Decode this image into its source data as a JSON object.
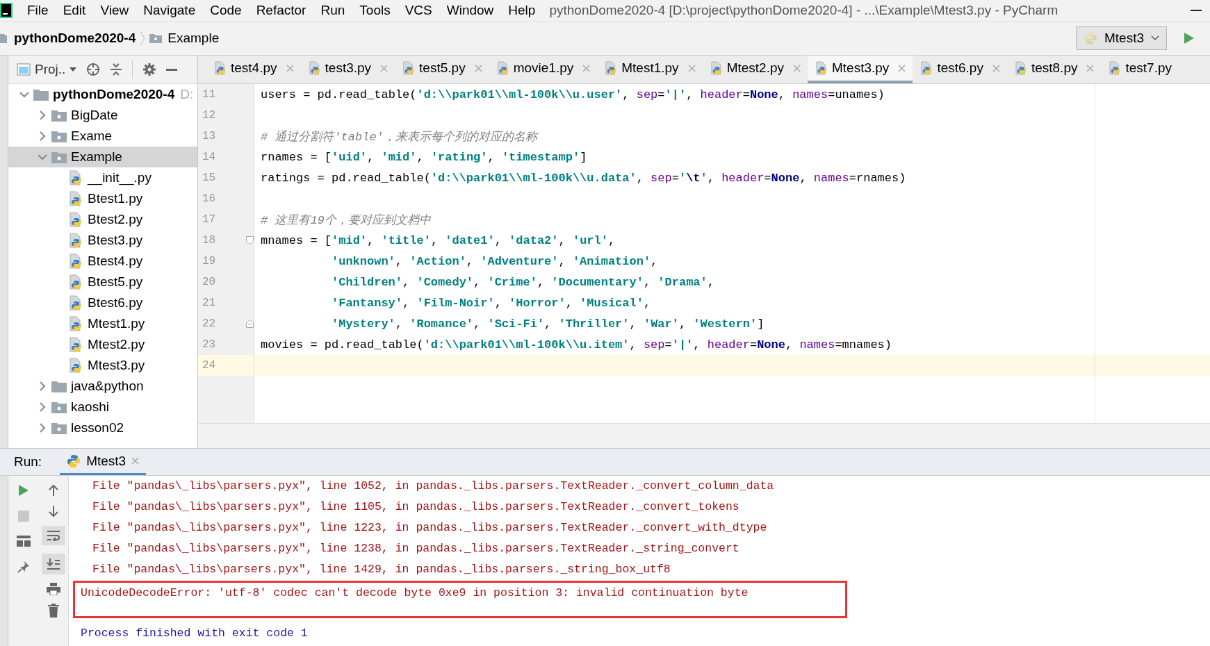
{
  "window": {
    "title": "pythonDome2020-4 [D:\\project\\pythonDome2020-4] - ...\\Example\\Mtest3.py - PyCharm"
  },
  "menu": [
    "File",
    "Edit",
    "View",
    "Navigate",
    "Code",
    "Refactor",
    "Run",
    "Tools",
    "VCS",
    "Window",
    "Help"
  ],
  "breadcrumb": [
    {
      "label": "pythonDome2020-4",
      "kind": "project"
    },
    {
      "label": "Example",
      "kind": "folder"
    }
  ],
  "run_config": {
    "label": "Mtest3"
  },
  "project_panel": {
    "title": "Proj..",
    "tree": [
      {
        "label": "pythonDome2020-4",
        "hint": "D:",
        "kind": "project",
        "expanded": true,
        "selected": false,
        "children": [
          {
            "label": "BigDate",
            "kind": "package",
            "expanded": false,
            "selected": false
          },
          {
            "label": "Exame",
            "kind": "package",
            "expanded": false,
            "selected": false
          },
          {
            "label": "Example",
            "kind": "package",
            "expanded": true,
            "selected": true,
            "children": [
              {
                "label": "__init__.py",
                "kind": "python",
                "selected": false
              },
              {
                "label": "Btest1.py",
                "kind": "python",
                "selected": false
              },
              {
                "label": "Btest2.py",
                "kind": "python",
                "selected": false
              },
              {
                "label": "Btest3.py",
                "kind": "python",
                "selected": false
              },
              {
                "label": "Btest4.py",
                "kind": "python",
                "selected": false
              },
              {
                "label": "Btest5.py",
                "kind": "python",
                "selected": false
              },
              {
                "label": "Btest6.py",
                "kind": "python",
                "selected": false
              },
              {
                "label": "Mtest1.py",
                "kind": "python",
                "selected": false
              },
              {
                "label": "Mtest2.py",
                "kind": "python",
                "selected": false
              },
              {
                "label": "Mtest3.py",
                "kind": "python",
                "selected": false
              }
            ]
          },
          {
            "label": "java&python",
            "kind": "folder",
            "expanded": false,
            "selected": false
          },
          {
            "label": "kaoshi",
            "kind": "package",
            "expanded": false,
            "selected": false
          },
          {
            "label": "lesson02",
            "kind": "package",
            "expanded": false,
            "selected": false
          }
        ]
      }
    ]
  },
  "editor_tabs": [
    {
      "label": "test4.py",
      "selected": false
    },
    {
      "label": "test3.py",
      "selected": false
    },
    {
      "label": "test5.py",
      "selected": false
    },
    {
      "label": "movie1.py",
      "selected": false
    },
    {
      "label": "Mtest1.py",
      "selected": false
    },
    {
      "label": "Mtest2.py",
      "selected": false
    },
    {
      "label": "Mtest3.py",
      "selected": true
    },
    {
      "label": "test6.py",
      "selected": false
    },
    {
      "label": "test8.py",
      "selected": false
    },
    {
      "label": "test7.py",
      "selected": false
    }
  ],
  "code_lines": [
    {
      "number": "11",
      "current": false,
      "kind": "plain",
      "indented": false,
      "tokens": [
        {
          "text": "users = pd.read_table(",
          "kind": "plain"
        },
        {
          "text": "'d:\\\\park01\\\\ml-100k\\\\u.user'",
          "kind": "string"
        },
        {
          "text": ", ",
          "kind": "plain"
        },
        {
          "text": "sep",
          "kind": "param"
        },
        {
          "text": "=",
          "kind": "plain"
        },
        {
          "text": "'|'",
          "kind": "string"
        },
        {
          "text": ", ",
          "kind": "plain"
        },
        {
          "text": "header",
          "kind": "param"
        },
        {
          "text": "=",
          "kind": "plain"
        },
        {
          "text": "None",
          "kind": "constant"
        },
        {
          "text": ", ",
          "kind": "plain"
        },
        {
          "text": "names",
          "kind": "param"
        },
        {
          "text": "=unames)",
          "kind": "plain"
        }
      ]
    },
    {
      "number": "12",
      "current": false,
      "kind": "plain"
    },
    {
      "number": "13",
      "current": false,
      "kind": "plain",
      "indented": false,
      "tokens": [
        {
          "text": "# 通过分割符'table'，来表示每个列的对应的名称",
          "kind": "comment"
        }
      ]
    },
    {
      "number": "14",
      "current": false,
      "kind": "plain",
      "indented": false,
      "tokens": [
        {
          "text": "rnames = [",
          "kind": "plain"
        },
        {
          "text": "'uid'",
          "kind": "string"
        },
        {
          "text": ", ",
          "kind": "plain"
        },
        {
          "text": "'mid'",
          "kind": "string"
        },
        {
          "text": ", ",
          "kind": "plain"
        },
        {
          "text": "'rating'",
          "kind": "string"
        },
        {
          "text": ", ",
          "kind": "plain"
        },
        {
          "text": "'timestamp'",
          "kind": "string"
        },
        {
          "text": "]",
          "kind": "plain"
        }
      ]
    },
    {
      "number": "15",
      "current": false,
      "kind": "plain",
      "indented": false,
      "tokens": [
        {
          "text": "ratings = pd.read_table(",
          "kind": "plain"
        },
        {
          "text": "'d:\\\\park01\\\\ml-100k\\\\u.data'",
          "kind": "string"
        },
        {
          "text": ", ",
          "kind": "plain"
        },
        {
          "text": "sep",
          "kind": "param"
        },
        {
          "text": "=",
          "kind": "plain"
        },
        {
          "text": "'",
          "kind": "string"
        },
        {
          "text": "\\t",
          "kind": "escape"
        },
        {
          "text": "'",
          "kind": "string"
        },
        {
          "text": ", ",
          "kind": "plain"
        },
        {
          "text": "header",
          "kind": "param"
        },
        {
          "text": "=",
          "kind": "plain"
        },
        {
          "text": "None",
          "kind": "constant"
        },
        {
          "text": ", ",
          "kind": "plain"
        },
        {
          "text": "names",
          "kind": "param"
        },
        {
          "text": "=rnames)",
          "kind": "plain"
        }
      ]
    },
    {
      "number": "16",
      "current": false,
      "kind": "plain"
    },
    {
      "number": "17",
      "current": false,
      "kind": "plain",
      "indented": false,
      "tokens": [
        {
          "text": "# 这里有19个，要对应到文档中",
          "kind": "comment"
        }
      ]
    },
    {
      "number": "18",
      "current": false,
      "kind": "fold-start",
      "indented": false,
      "tokens": [
        {
          "text": "mnames = [",
          "kind": "plain"
        },
        {
          "text": "'mid'",
          "kind": "string"
        },
        {
          "text": ", ",
          "kind": "plain"
        },
        {
          "text": "'title'",
          "kind": "string"
        },
        {
          "text": ", ",
          "kind": "plain"
        },
        {
          "text": "'date1'",
          "kind": "string"
        },
        {
          "text": ", ",
          "kind": "plain"
        },
        {
          "text": "'data2'",
          "kind": "string"
        },
        {
          "text": ", ",
          "kind": "plain"
        },
        {
          "text": "'url'",
          "kind": "string"
        },
        {
          "text": ",",
          "kind": "plain"
        }
      ]
    },
    {
      "number": "19",
      "current": false,
      "kind": "plain",
      "indented": true,
      "tokens": [
        {
          "text": "'unknown'",
          "kind": "string"
        },
        {
          "text": ", ",
          "kind": "plain"
        },
        {
          "text": "'Action'",
          "kind": "string"
        },
        {
          "text": ", ",
          "kind": "plain"
        },
        {
          "text": "'Adventure'",
          "kind": "string"
        },
        {
          "text": ", ",
          "kind": "plain"
        },
        {
          "text": "'Animation'",
          "kind": "string"
        },
        {
          "text": ",",
          "kind": "plain"
        }
      ]
    },
    {
      "number": "20",
      "current": false,
      "kind": "plain",
      "indented": true,
      "tokens": [
        {
          "text": "'Children'",
          "kind": "string"
        },
        {
          "text": ", ",
          "kind": "plain"
        },
        {
          "text": "'Comedy'",
          "kind": "string"
        },
        {
          "text": ", ",
          "kind": "plain"
        },
        {
          "text": "'Crime'",
          "kind": "string"
        },
        {
          "text": ", ",
          "kind": "plain"
        },
        {
          "text": "'Documentary'",
          "kind": "string"
        },
        {
          "text": ", ",
          "kind": "plain"
        },
        {
          "text": "'Drama'",
          "kind": "string"
        },
        {
          "text": ",",
          "kind": "plain"
        }
      ]
    },
    {
      "number": "21",
      "current": false,
      "kind": "plain",
      "indented": true,
      "tokens": [
        {
          "text": "'Fantansy'",
          "kind": "string"
        },
        {
          "text": ", ",
          "kind": "plain"
        },
        {
          "text": "'Film-Noir'",
          "kind": "string"
        },
        {
          "text": ", ",
          "kind": "plain"
        },
        {
          "text": "'Horror'",
          "kind": "string"
        },
        {
          "text": ", ",
          "kind": "plain"
        },
        {
          "text": "'Musical'",
          "kind": "string"
        },
        {
          "text": ",",
          "kind": "plain"
        }
      ]
    },
    {
      "number": "22",
      "current": false,
      "kind": "fold-end",
      "indented": true,
      "tokens": [
        {
          "text": "'Mystery'",
          "kind": "string"
        },
        {
          "text": ", ",
          "kind": "plain"
        },
        {
          "text": "'Romance'",
          "kind": "string"
        },
        {
          "text": ", ",
          "kind": "plain"
        },
        {
          "text": "'Sci-Fi'",
          "kind": "string"
        },
        {
          "text": ", ",
          "kind": "plain"
        },
        {
          "text": "'Thriller'",
          "kind": "string"
        },
        {
          "text": ", ",
          "kind": "plain"
        },
        {
          "text": "'War'",
          "kind": "string"
        },
        {
          "text": ", ",
          "kind": "plain"
        },
        {
          "text": "'Western'",
          "kind": "string"
        },
        {
          "text": "]",
          "kind": "plain"
        }
      ]
    },
    {
      "number": "23",
      "current": false,
      "kind": "plain",
      "indented": false,
      "tokens": [
        {
          "text": "movies = pd.read_table(",
          "kind": "plain"
        },
        {
          "text": "'d:\\\\park01\\\\ml-100k\\\\u.item'",
          "kind": "string"
        },
        {
          "text": ", ",
          "kind": "plain"
        },
        {
          "text": "sep",
          "kind": "param"
        },
        {
          "text": "=",
          "kind": "plain"
        },
        {
          "text": "'|'",
          "kind": "string"
        },
        {
          "text": ", ",
          "kind": "plain"
        },
        {
          "text": "header",
          "kind": "param"
        },
        {
          "text": "=",
          "kind": "plain"
        },
        {
          "text": "None",
          "kind": "constant"
        },
        {
          "text": ", ",
          "kind": "plain"
        },
        {
          "text": "names",
          "kind": "param"
        },
        {
          "text": "=mnames)",
          "kind": "plain"
        }
      ]
    },
    {
      "number": "24",
      "current": true,
      "kind": "plain"
    }
  ],
  "run_panel": {
    "label": "Run:",
    "tabs": [
      {
        "label": "Mtest3",
        "selected": true
      }
    ],
    "console": [
      {
        "text": "File \"pandas\\_libs\\parsers.pyx\", line 1052, in pandas._libs.parsers.TextReader._convert_column_data",
        "kind": "trace",
        "highlighted": false
      },
      {
        "text": "File \"pandas\\_libs\\parsers.pyx\", line 1105, in pandas._libs.parsers.TextReader._convert_tokens",
        "kind": "trace",
        "highlighted": false
      },
      {
        "text": "File \"pandas\\_libs\\parsers.pyx\", line 1223, in pandas._libs.parsers.TextReader._convert_with_dtype",
        "kind": "trace",
        "highlighted": false
      },
      {
        "text": "File \"pandas\\_libs\\parsers.pyx\", line 1238, in pandas._libs.parsers.TextReader._string_convert",
        "kind": "trace",
        "highlighted": false
      },
      {
        "text": "File \"pandas\\_libs\\parsers.pyx\", line 1429, in pandas._libs.parsers._string_box_utf8",
        "kind": "trace",
        "highlighted": false
      },
      {
        "text": "UnicodeDecodeError: 'utf-8' codec can't decode byte 0xe9 in position 3: invalid continuation byte",
        "kind": "error",
        "highlighted": true
      },
      {
        "text": "Process finished with exit code 1",
        "kind": "info",
        "highlighted": false
      }
    ]
  }
}
